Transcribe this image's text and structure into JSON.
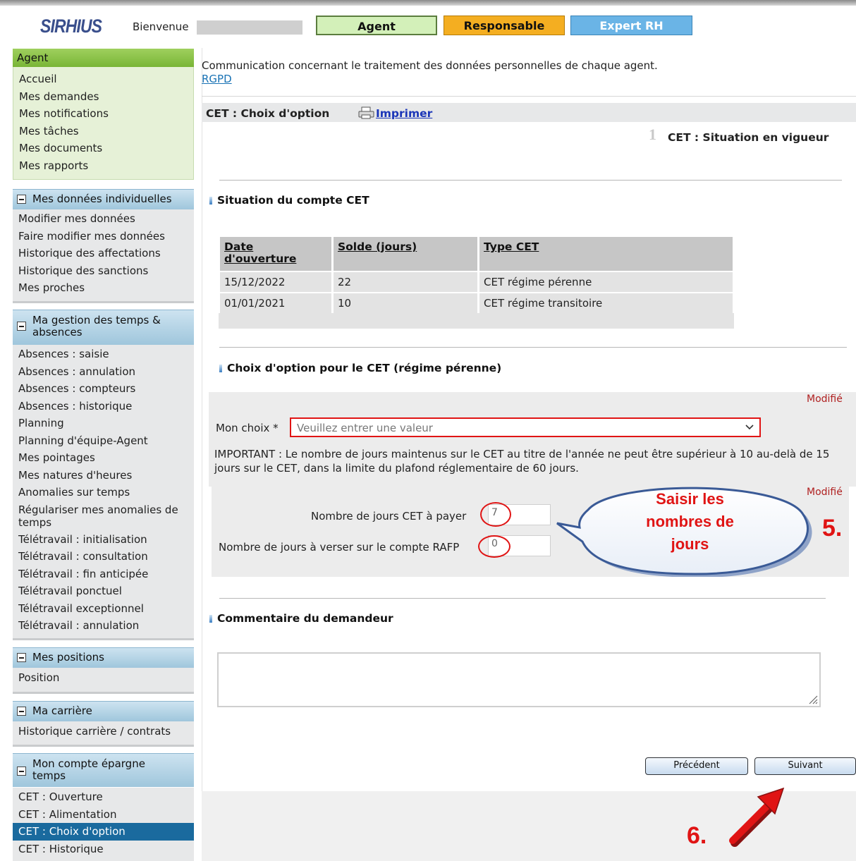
{
  "header": {
    "logo": "SIRHIUS",
    "welcome": "Bienvenue",
    "roles": [
      "Agent",
      "Responsable",
      "Expert RH"
    ]
  },
  "sidebar": {
    "agent": {
      "title": "Agent",
      "items": [
        "Accueil",
        "Mes demandes",
        "Mes notifications",
        "Mes tâches",
        "Mes documents",
        "Mes rapports"
      ]
    },
    "donnees": {
      "title": "Mes données individuelles",
      "items": [
        "Modifier mes données",
        "Faire modifier mes données",
        "Historique des affectations",
        "Historique des sanctions",
        "Mes proches"
      ]
    },
    "temps": {
      "title_line1": "Ma gestion des temps &",
      "title_line2": "absences",
      "items": [
        "Absences : saisie",
        "Absences : annulation",
        "Absences : compteurs",
        "Absences : historique",
        "Planning",
        "Planning d'équipe-Agent",
        "Mes pointages",
        "Mes natures d'heures",
        "Anomalies sur temps",
        "Régulariser mes anomalies de",
        "temps",
        "Télétravail : initialisation",
        "Télétravail : consultation",
        "Télétravail : fin anticipée",
        "Télétravail ponctuel",
        "Télétravail exceptionnel",
        "Télétravail : annulation"
      ]
    },
    "positions": {
      "title": "Mes positions",
      "items": [
        "Position"
      ]
    },
    "carriere": {
      "title": "Ma carrière",
      "items": [
        "Historique carrière / contrats"
      ]
    },
    "cet": {
      "title_line1": "Mon compte épargne",
      "title_line2": "temps",
      "items": [
        "CET : Ouverture",
        "CET : Alimentation",
        "CET : Choix d'option",
        "CET : Historique"
      ],
      "active": "CET : Choix d'option"
    }
  },
  "main": {
    "communication": "Communication concernant le traitement des données personnelles de chaque agent.",
    "rgpd_link": "RGPD",
    "page_title": "CET : Choix d'option",
    "print_label": "Imprimer",
    "step_number": "1",
    "step_label": "CET : Situation en vigueur",
    "situation_title": "Situation du compte CET",
    "table": {
      "headers": [
        "Date d'ouverture",
        "Solde (jours)",
        "Type CET"
      ],
      "rows": [
        [
          "15/12/2022",
          "22",
          "CET régime pérenne"
        ],
        [
          "01/01/2021",
          "10",
          "CET régime transitoire"
        ]
      ]
    },
    "choix_title": "Choix d'option pour le CET (régime pérenne)",
    "modified_label": "Modifié",
    "mon_choix_label": "Mon choix *",
    "mon_choix_placeholder": "Veuillez entrer une valeur",
    "important_text": "IMPORTANT : Le nombre de jours maintenus sur le CET au titre de l'année ne peut être supérieur à 10 au-delà de 15 jours sur le CET, dans la limite du plafond réglementaire de 60 jours.",
    "jours_payer_label": "Nombre de jours CET à payer",
    "jours_payer_value": "7",
    "jours_rafp_label": "Nombre de jours à verser sur le compte RAFP",
    "jours_rafp_value": "0",
    "commentaire_title": "Commentaire du demandeur",
    "commentaire_value": "",
    "btn_precedent": "Précédent",
    "btn_suivant": "Suivant"
  },
  "annotations": {
    "callout_line1": "Saisir les",
    "callout_line2": "nombres de",
    "callout_line3": "jours",
    "step5": "5.",
    "step6": "6."
  },
  "colors": {
    "accent_red": "#e01414",
    "active_blue": "#1a6a9e",
    "agent_green": "#79b536"
  }
}
